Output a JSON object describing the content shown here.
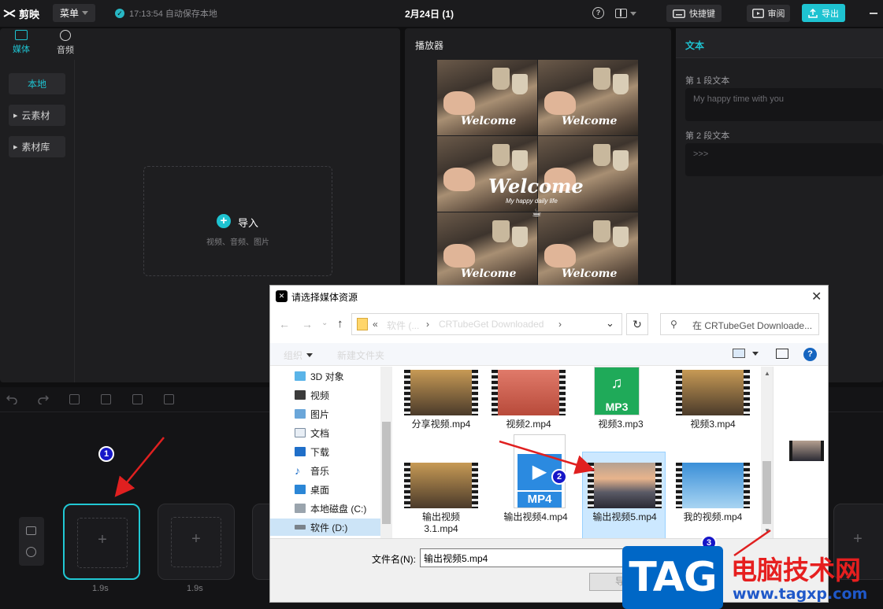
{
  "app": {
    "logo_text": "剪映",
    "menu_label": "菜单",
    "autosave_text": "17:13:54 自动保存本地",
    "project_title": "2月24日 (1)",
    "shortcut_label": "快捷键",
    "review_label": "审阅",
    "export_label": "导出"
  },
  "media": {
    "tabs": [
      {
        "label": "媒体"
      },
      {
        "label": "音频"
      }
    ],
    "sidebar": [
      {
        "label": "本地"
      },
      {
        "label": "云素材"
      },
      {
        "label": "素材库"
      }
    ],
    "import_label": "导入",
    "import_hint": "视频、音频、图片"
  },
  "player": {
    "title": "播放器",
    "tile_word": "Welcome",
    "big_word": "Welcome",
    "big_sub": "My happy daily life"
  },
  "text_panel": {
    "title": "文本",
    "fields": [
      {
        "label": "第 1 段文本",
        "placeholder": "My happy time with you"
      },
      {
        "label": "第 2 段文本",
        "placeholder": ">>>"
      }
    ]
  },
  "timeline": {
    "slots": [
      {
        "duration": "1.9s"
      },
      {
        "duration": "1.9s"
      }
    ]
  },
  "annotations": {
    "one": "1",
    "two": "2",
    "three": "3"
  },
  "dialog": {
    "title": "请选择媒体资源",
    "breadcrumb": [
      "软件 (...",
      "CRTubeGet Downloaded"
    ],
    "search_placeholder": "在 CRTubeGet Downloade...",
    "organize_label": "组织",
    "new_folder_label": "新建文件夹",
    "tree": [
      {
        "label": "3D 对象"
      },
      {
        "label": "视频"
      },
      {
        "label": "图片"
      },
      {
        "label": "文档"
      },
      {
        "label": "下载"
      },
      {
        "label": "音乐"
      },
      {
        "label": "桌面"
      },
      {
        "label": "本地磁盘 (C:)"
      },
      {
        "label": "软件 (D:)"
      }
    ],
    "files": [
      {
        "name": "分享视频.mp4"
      },
      {
        "name": "视频2.mp4"
      },
      {
        "name": "视频3.mp3",
        "badge": "MP3"
      },
      {
        "name": "视频3.mp4"
      },
      {
        "name": "输出视频\n3.1.mp4"
      },
      {
        "name": "输出视频4.mp4",
        "badge": "MP4"
      },
      {
        "name": "输出视频5.mp4"
      },
      {
        "name": "我的视频.mp4"
      }
    ],
    "filename_label": "文件名(N):",
    "filename_value": "输出视频5.mp4",
    "open_label": "导入"
  },
  "watermark": {
    "tag": "TAG",
    "cn": "电脑技术网",
    "url": "www.tagxp.com"
  },
  "colors": {
    "accent": "#1ec3d1",
    "badge_blue": "#1616c8",
    "arrow_red": "#e02020",
    "watermark_blue": "#0067c6",
    "watermark_red": "#e61f1f"
  }
}
